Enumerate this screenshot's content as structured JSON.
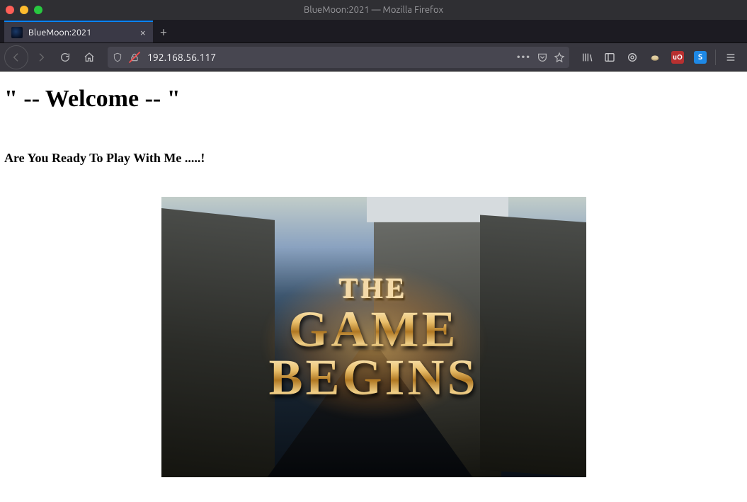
{
  "window": {
    "title": "BlueMoon:2021 — Mozilla Firefox"
  },
  "tabs": [
    {
      "title": "BlueMoon:2021"
    }
  ],
  "urlbar": {
    "address": "192.168.56.117"
  },
  "page": {
    "heading": "\" -- Welcome -- \"",
    "subheading": "Are You Ready To Play With Me .....!",
    "hero_text_line1": "THE",
    "hero_text_line2": "GAME",
    "hero_text_line3": "BEGINS"
  }
}
